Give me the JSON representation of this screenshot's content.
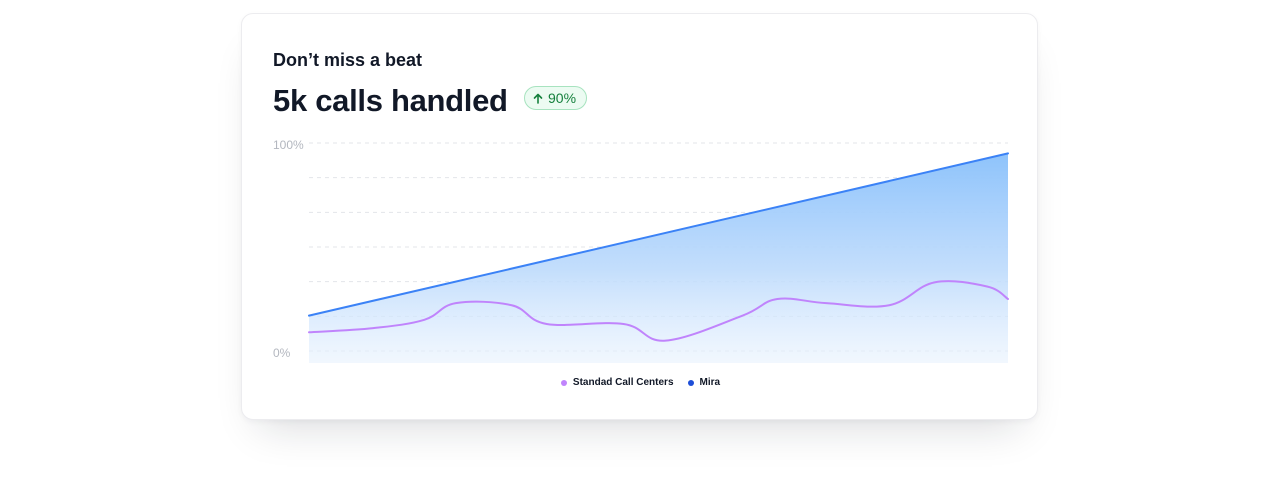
{
  "card": {
    "subtitle": "Don’t miss a beat",
    "headline": "5k calls handled",
    "badge": {
      "icon": "arrow-up-icon",
      "text": "90%",
      "color": "#15803d"
    }
  },
  "chart_data": {
    "type": "area",
    "y_tick_labels": [
      "100%",
      "0%"
    ],
    "ylim": [
      0,
      100
    ],
    "grid": "horizontal-dashed",
    "legend_placement": "bottom-center",
    "series": [
      {
        "name": "Standad Call Centers",
        "color": "#c084fc",
        "points": [
          [
            0.0,
            9
          ],
          [
            9.2,
            11
          ],
          [
            16.5,
            15
          ],
          [
            21,
            23
          ],
          [
            29,
            22
          ],
          [
            34,
            13
          ],
          [
            45,
            13
          ],
          [
            51,
            5
          ],
          [
            62,
            17
          ],
          [
            67,
            25
          ],
          [
            74,
            23
          ],
          [
            83,
            22
          ],
          [
            89.5,
            33
          ],
          [
            97,
            31
          ],
          [
            100,
            25
          ]
        ]
      },
      {
        "name": "Mira",
        "color": "#3b82f6",
        "legend_color": "#1d4ed8",
        "points": [
          [
            0,
            17
          ],
          [
            100,
            95
          ]
        ]
      }
    ]
  }
}
